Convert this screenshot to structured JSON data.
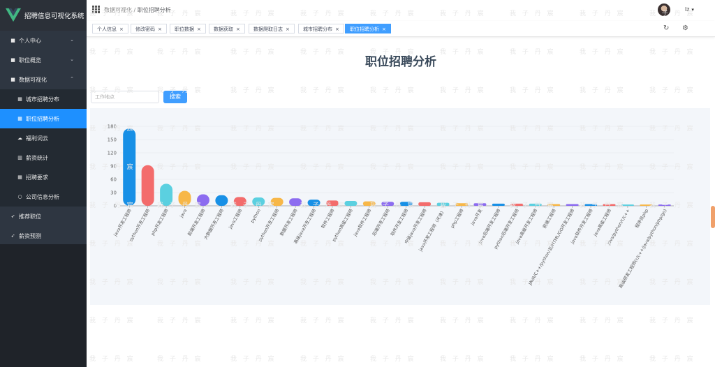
{
  "app": {
    "title": "招聘信息可视化系统"
  },
  "sidebar": {
    "items": [
      {
        "label": "个人中心",
        "arrow": "⌄"
      },
      {
        "label": "职位概览",
        "arrow": "⌄"
      },
      {
        "label": "数据可视化",
        "arrow": "⌃"
      },
      {
        "label": "城市招聘分布"
      },
      {
        "label": "职位招聘分析"
      },
      {
        "label": "福利词云"
      },
      {
        "label": "薪资统计"
      },
      {
        "label": "招聘要求"
      },
      {
        "label": "公司信息分析"
      },
      {
        "label": "推荐职位"
      },
      {
        "label": "薪资预测"
      }
    ]
  },
  "header": {
    "breadcrumb_parent": "数据可视化",
    "breadcrumb_sep": "/",
    "breadcrumb_current": "职位招聘分析",
    "username": "lz",
    "caret": "▾"
  },
  "tags": [
    {
      "label": "个人信息",
      "x": "×"
    },
    {
      "label": "修改密码",
      "x": "×"
    },
    {
      "label": "职位数据",
      "x": "×"
    },
    {
      "label": "数据获取",
      "x": "×"
    },
    {
      "label": "数据爬取日志",
      "x": "×"
    },
    {
      "label": "城市招聘分布",
      "x": "×"
    },
    {
      "label": "职位招聘分析",
      "x": "×"
    }
  ],
  "icons": {
    "refresh": "↻",
    "settings": "⚙"
  },
  "page": {
    "title": "职位招聘分析"
  },
  "search": {
    "placeholder": "工作地点",
    "button": "搜索"
  },
  "watermark": "我 子 丹 宸",
  "chart_data": {
    "type": "bar",
    "ylim": [
      0,
      180
    ],
    "yticks": [
      0,
      30,
      60,
      90,
      120,
      150,
      180
    ],
    "grid": true,
    "categories": [
      "java开发工程师",
      "python开发工程师",
      "php开发工程师",
      "java",
      "前端开发工程师",
      "大数据开发工程师",
      "java工程师",
      "python",
      "python开发工程师",
      "数据开发工程师",
      "高级java开发工程师",
      "软件工程师",
      "python高级工程师",
      "java软件工程师",
      "后端开发工程师",
      "软件开发工程师",
      "中级java开发工程师",
      "java开发工程师（天津）",
      "php工程师",
      "java开发",
      "java后端开发工程师",
      "python后端开发工程师",
      "java高级开发工程师",
      "前端工程师",
      "JAVA/C++/python/五/HTML/GO开发工程师",
      "java软件开发工程师",
      "java高级工程师",
      "java/python/c/c++",
      "程序员php",
      "高级研发工程师(c/c++/java/python/php/go)"
    ],
    "values": [
      175,
      92,
      50,
      34,
      26,
      24,
      20,
      19,
      18,
      17,
      14,
      12,
      11,
      10,
      9,
      9,
      8,
      7,
      6,
      6,
      5,
      5,
      5,
      4,
      4,
      4,
      4,
      3,
      3,
      3
    ],
    "colors": [
      "#1890e6",
      "#f36c6c",
      "#5bd0e0",
      "#f7b748",
      "#8c6cf0"
    ]
  }
}
